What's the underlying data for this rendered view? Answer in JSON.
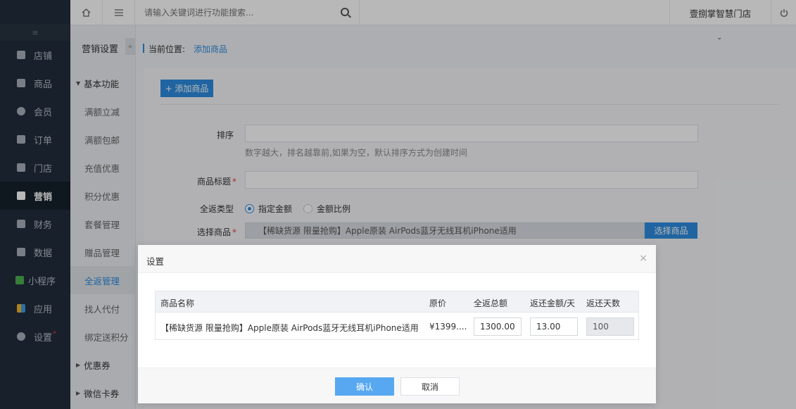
{
  "topbar": {
    "home_icon": "home-icon",
    "menu_icon": "menu-icon",
    "search_placeholder": "请输入关键词进行功能搜索...",
    "store_name": "壹捌掌智慧门店",
    "power_icon": "power-icon"
  },
  "sidebar": {
    "collapse_glyph": "≡",
    "items": [
      {
        "label": "店铺",
        "icon": "store-icon"
      },
      {
        "label": "商品",
        "icon": "goods-icon"
      },
      {
        "label": "会员",
        "icon": "member-icon"
      },
      {
        "label": "订单",
        "icon": "order-icon"
      },
      {
        "label": "门店",
        "icon": "shop-icon"
      },
      {
        "label": "营销",
        "icon": "gift-icon"
      },
      {
        "label": "财务",
        "icon": "finance-icon"
      },
      {
        "label": "数据",
        "icon": "chart-icon"
      },
      {
        "label": "小程序",
        "icon": "miniapp-icon"
      },
      {
        "label": "应用",
        "icon": "apps-icon"
      },
      {
        "label": "设置",
        "icon": "settings-icon"
      }
    ],
    "active": "营销"
  },
  "submenu": {
    "title": "营销设置",
    "toggle_glyph": "«",
    "groups": [
      {
        "label": "基本功能",
        "expanded": true
      },
      {
        "label": "优惠券",
        "expanded": false
      },
      {
        "label": "微信卡券",
        "expanded": false
      }
    ],
    "items": [
      "满额立减",
      "满额包邮",
      "充值优惠",
      "积分优惠",
      "套餐管理",
      "赠品管理",
      "全返管理",
      "找人代付",
      "绑定送积分"
    ],
    "active": "全返管理"
  },
  "breadcrumb": {
    "label": "当前位置:",
    "current": "添加商品"
  },
  "form": {
    "add_button": "+ 添加商品",
    "sort_label": "排序",
    "sort_help": "数字越大，排名越靠前,如果为空，默认排序方式为创建时间",
    "title_label": "商品标题",
    "type_label": "全返类型",
    "type_options": [
      "指定金额",
      "金额比例"
    ],
    "type_selected": "指定金额",
    "product_label": "选择商品",
    "product_value": "【稀缺货源 限量抢购】Apple原装 AirPods蓝牙无线耳机iPhone适用",
    "product_button": "选择商品",
    "required_mark": "*"
  },
  "dialog": {
    "title": "设置",
    "close_glyph": "×",
    "columns": [
      "商品名称",
      "原价",
      "全返总额",
      "返还金额/天",
      "返还天数"
    ],
    "row": {
      "name": "【稀缺货源 限量抢购】Apple原装 AirPods蓝牙无线耳机iPhone适用",
      "price": "¥1399....",
      "total": "1300.00",
      "per_day": "13.00",
      "days": "100"
    },
    "confirm": "确认",
    "cancel": "取消"
  },
  "colors": {
    "accent": "#2d8ce0",
    "sidebar_bg": "#222d3c",
    "required": "#e0433b"
  }
}
